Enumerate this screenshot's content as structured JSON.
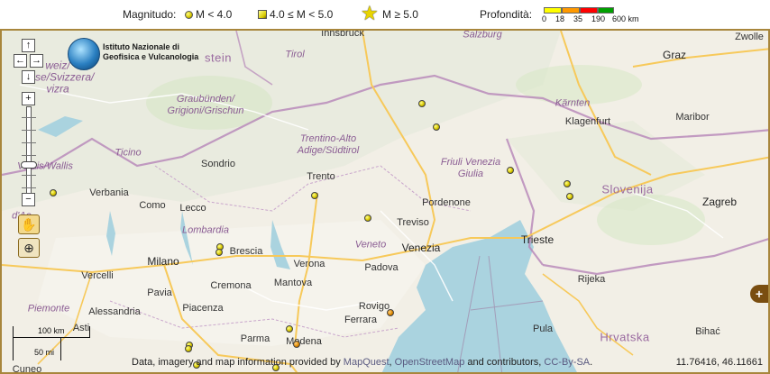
{
  "legend": {
    "magnitude_label": "Magnitudo:",
    "small_label": "M < 4.0",
    "medium_label": "4.0 ≤ M < 5.0",
    "large_label": "M ≥ 5.0",
    "depth_label": "Profondità:",
    "depth_ticks": [
      "0",
      "18",
      "35",
      "190",
      "600 km"
    ],
    "depth_colors": [
      "#ffff00",
      "#ff9900",
      "#ff0000",
      "#00a000"
    ]
  },
  "logo": {
    "line1": "Istituto Nazionale di",
    "line2": "Geofisica e Vulcanologia"
  },
  "nav": {
    "up": "↑",
    "left": "←",
    "right": "→",
    "down": "↓",
    "zoom_in": "+",
    "zoom_out": "−",
    "pan_icon": "hand-icon",
    "zoombox_icon": "magnifier-plus-icon"
  },
  "places": {
    "innsbruck": "Innsbruck",
    "salzburg": "Salzburg",
    "zwolle": "Zwolle",
    "graz": "Graz",
    "tirol": "Tirol",
    "liechtenstein": "stein",
    "schweiz": "weiz/\nuisse/Svizzera/\nvizra",
    "graubunden": "Graubünden/\nGrigioni/Grischun",
    "karnten": "Kärnten",
    "klagenfurt": "Klagenfurt",
    "maribor": "Maribor",
    "ticino": "Ticino",
    "trentino": "Trentino-Alto\nAdige/Südtirol",
    "friuli": "Friuli Venezia\nGiulia",
    "sondrio": "Sondrio",
    "wallis": "Valais/Wallis",
    "trento": "Trento",
    "slovenija": "Slovenija",
    "verbania": "Verbania",
    "como": "Como",
    "lecco": "Lecco",
    "pordenone": "Pordenone",
    "zagreb": "Zagreb",
    "treviso": "Treviso",
    "lombardia": "Lombardia",
    "venezia": "Venezia",
    "aosta": "d'Ao",
    "brescia": "Brescia",
    "veneto": "Veneto",
    "trieste": "Trieste",
    "milano": "Milano",
    "verona": "Verona",
    "padova": "Padova",
    "vercelli": "Vercelli",
    "cremona": "Cremona",
    "mantova": "Mantova",
    "rijeka": "Rijeka",
    "pavia": "Pavia",
    "rovigo": "Rovigo",
    "piemonte": "Piemonte",
    "alessandria": "Alessandria",
    "piacenza": "Piacenza",
    "ferrara": "Ferrara",
    "asti": "Asti",
    "pula": "Pula",
    "hrvatska": "Hrvatska",
    "parma": "Parma",
    "modena": "Modena",
    "bihac": "Bihać",
    "cuneo": "Cuneo"
  },
  "scalebar": {
    "km": "100 km",
    "mi": "50 mi"
  },
  "attribution": {
    "prefix": "Data, imagery and map information provided by ",
    "mapquest": "MapQuest",
    "sep1": ", ",
    "osm": "OpenStreetMap",
    "middle": " and contributors, ",
    "license": "CC-By-SA",
    "suffix": "."
  },
  "coords": "11.76416, 46.11661",
  "layer_switch_label": "+",
  "quakes": [
    {
      "id": "q1"
    },
    {
      "id": "q2"
    },
    {
      "id": "q3"
    },
    {
      "id": "q4"
    },
    {
      "id": "q5"
    },
    {
      "id": "q6"
    },
    {
      "id": "q7"
    },
    {
      "id": "q8"
    },
    {
      "id": "q9"
    },
    {
      "id": "q10"
    },
    {
      "id": "q11"
    },
    {
      "id": "q12"
    },
    {
      "id": "q13"
    },
    {
      "id": "q14"
    },
    {
      "id": "q15"
    },
    {
      "id": "q16"
    },
    {
      "id": "q17"
    }
  ],
  "colors": {
    "frame": "#a8863c",
    "water": "#aad3df",
    "land": "#f2efe6",
    "border": "#b584b8",
    "road": "#f7c95a"
  }
}
